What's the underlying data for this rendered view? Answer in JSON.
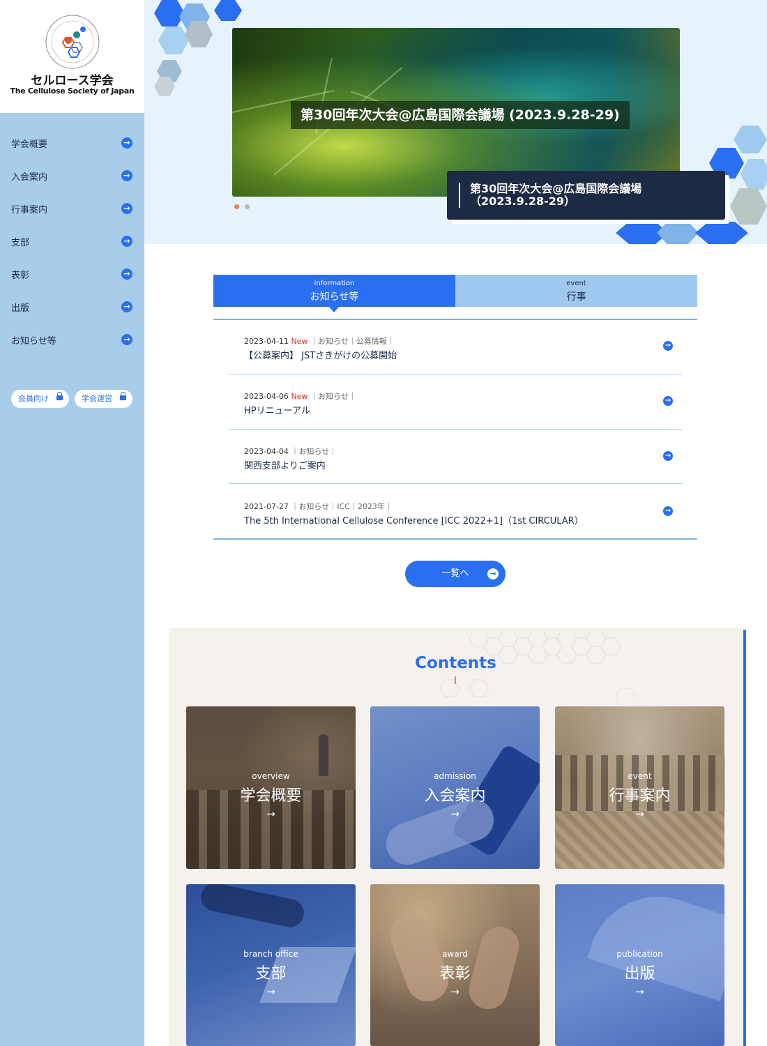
{
  "brand": {
    "name_jp": "セルロース学会",
    "name_en": "The Cellulose Society of Japan",
    "accent": "#2a6ff0",
    "sidebar_bg": "#a8cdea",
    "navy": "#1d2a44"
  },
  "sidebar": {
    "items": [
      {
        "label": "学会概要",
        "icon": "arrow-right-circle-icon"
      },
      {
        "label": "入会案内",
        "icon": "arrow-right-circle-icon"
      },
      {
        "label": "行事案内",
        "icon": "arrow-right-circle-icon"
      },
      {
        "label": "支部",
        "icon": "arrow-right-circle-icon"
      },
      {
        "label": "表彰",
        "icon": "arrow-right-circle-icon"
      },
      {
        "label": "出版",
        "icon": "arrow-right-circle-icon"
      },
      {
        "label": "お知らせ等",
        "icon": "arrow-right-circle-icon"
      }
    ],
    "member_links": [
      {
        "label": "会員向け",
        "icon": "lock-icon"
      },
      {
        "label": "学会運営",
        "icon": "lock-icon"
      }
    ]
  },
  "hero": {
    "slide_title": "第30回年次大会@広島国際会議場 (2023.9.28-29)",
    "caption_line1": "第30回年次大会@広島国際会議場",
    "caption_line2": "（2023.9.28-29）",
    "slide_count": 2,
    "active_slide": 1
  },
  "tabs": [
    {
      "en": "information",
      "jp": "お知らせ等",
      "active": true
    },
    {
      "en": "event",
      "jp": "行事",
      "active": false
    }
  ],
  "news": [
    {
      "date": "2023-04-11",
      "new": "New",
      "categories": "お知らせ｜公募情報",
      "title": "【公募案内】 JSTさきがけの公募開始"
    },
    {
      "date": "2023-04-06",
      "new": "New",
      "categories": "お知らせ",
      "title": "HPリニューアル"
    },
    {
      "date": "2023-04-04",
      "new": "",
      "categories": "お知らせ",
      "title": "関西支部よりご案内"
    },
    {
      "date": "2021-07-27",
      "new": "",
      "categories": "お知らせ｜ICC｜2023年",
      "title": "The 5th International Cellulose Conference [ICC 2022+1]（1st CIRCULAR）"
    }
  ],
  "list_button": "一覧へ",
  "contents": {
    "title": "Contents",
    "cards": [
      {
        "en": "overview",
        "jp": "学会概要",
        "arrow": "→"
      },
      {
        "en": "admission",
        "jp": "入会案内",
        "arrow": "→"
      },
      {
        "en": "event",
        "jp": "行事案内",
        "arrow": "→"
      },
      {
        "en": "branch office",
        "jp": "支部",
        "arrow": "→"
      },
      {
        "en": "award",
        "jp": "表彰",
        "arrow": "→"
      },
      {
        "en": "publication",
        "jp": "出版",
        "arrow": "→"
      }
    ]
  }
}
